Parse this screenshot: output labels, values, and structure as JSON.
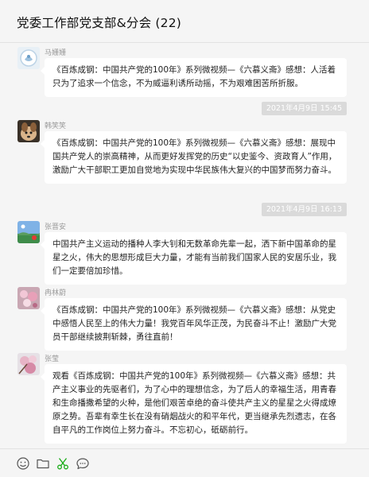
{
  "window": {
    "title": "党委工作部党支部&分会 (22)"
  },
  "messages": [
    {
      "sender": "马姗姗",
      "avatar": "avatar-light-blue",
      "text": "《百炼成钢：中国共产党的100年》系列微视频—《六慕义斋》感想：人活着只为了追求一个信念，不为威逼利诱所动摇，不为艰难困苦所折服。"
    },
    {
      "timestamp": "2021年4月9日 15:45",
      "sender": "韩笑笑",
      "avatar": "avatar-dog-photo",
      "text": "《百炼成钢：中国共产党的100年》系列微视频—《六慕义斋》感想：展现中国共产党人的崇高精神，从而更好发挥党的历史“以史鉴今、资政育人”作用，激励广大干部职工更加自觉地为实现中华民族伟大复兴的中国梦而努力奋斗。"
    },
    {
      "timestamp": "2021年4月9日 16:13",
      "sender": "张晋安",
      "avatar": "avatar-landscape-photo",
      "text": "中国共产主义运动的播种人李大钊和无数革命先辈一起，洒下新中国革命的星星之火，伟大的思想形成巨大力量，才能有当前我们国家人民的安居乐业，我们一定要倍加珍惜。"
    },
    {
      "sender": "冉林蔚",
      "avatar": "avatar-pink-flowers",
      "text": "《百炼成钢：中国共产党的100年》系列微视频—《六慕义斋》感想：从党史中感悟人民至上的伟大力量！我党百年风华正茂，为民奋斗不止！激励广大党员干部继续披荆斩棘，勇往直前！"
    },
    {
      "sender": "张莹",
      "avatar": "avatar-blossom-photo",
      "text": "观看《百炼成钢：中国共产党的100年》系列微视频—《六慕义斋》感想：共产主义事业的先驱者们，为了心中的理想信念，为了后人的幸福生活，用青春和生命播撒希望的火种，是他们艰苦卓绝的奋斗使共产主义的星星之火得成燎原之势。吾辈有幸生长在没有硝烟战火的和平年代，更当继承先烈遗志，在各自平凡的工作岗位上努力奋斗。不忘初心，砥砺前行。"
    }
  ],
  "toolbar": {
    "icons": [
      "emoji-icon",
      "folder-icon",
      "scissors-icon",
      "chat-bubble-icon"
    ]
  },
  "colors": {
    "background": "#f5f5f5",
    "bubble": "#ffffff",
    "timestamp_bg": "#dadada",
    "sender_name": "#9a9a9a",
    "scissors_green": "#1aad19"
  }
}
